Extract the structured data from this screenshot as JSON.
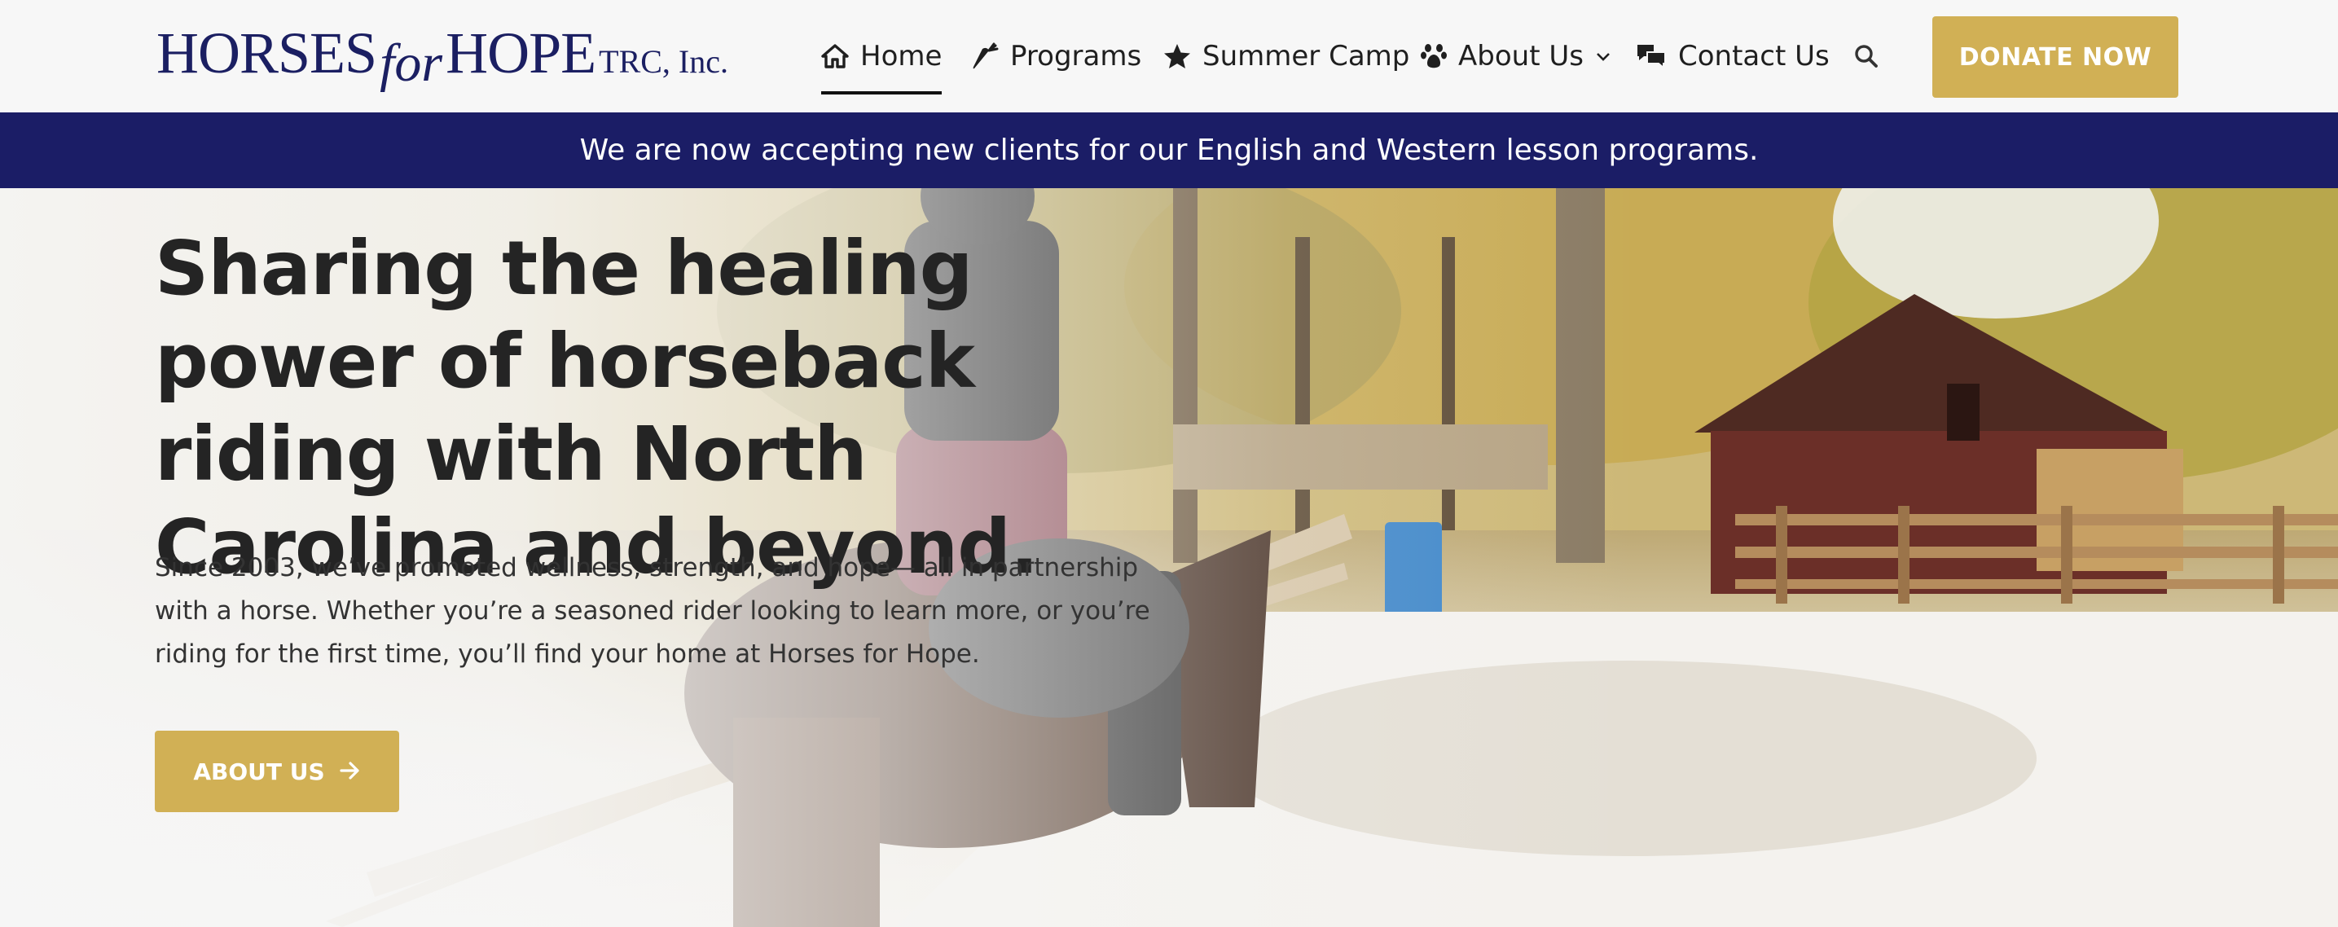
{
  "logo": {
    "word1": "HORSES",
    "word2": "for",
    "word3": "HOPE",
    "suffix": "TRC, Inc."
  },
  "nav": {
    "items": [
      {
        "label": "Home",
        "icon": "home-icon",
        "active": true
      },
      {
        "label": "Programs",
        "icon": "carrot-icon",
        "active": false
      },
      {
        "label": "Summer Camp",
        "icon": "star-icon",
        "active": false
      },
      {
        "label": "About Us",
        "icon": "paw-icon",
        "active": false,
        "dropdown": true
      },
      {
        "label": "Contact Us",
        "icon": "comments-icon",
        "active": false
      }
    ],
    "search_icon": "search-icon",
    "donate_label": "DONATE NOW"
  },
  "banner": {
    "text": "We are now accepting new clients for our English and Western lesson programs."
  },
  "hero": {
    "headline": "Sharing the healing power of horseback riding with North Carolina and beyond.",
    "paragraph": "Since 2003, we’ve promoted wellness, strength, and hope— all in partnership with a horse. Whether you’re a seasoned rider looking to learn more, or you’re riding for the first time, you’ll find your home at Horses for Hope.",
    "cta_label": "ABOUT US",
    "cta_icon": "arrow-right-icon"
  },
  "colors": {
    "brand_navy": "#1b1d66",
    "accent_gold": "#d1b055",
    "header_bg": "#f7f7f7"
  }
}
